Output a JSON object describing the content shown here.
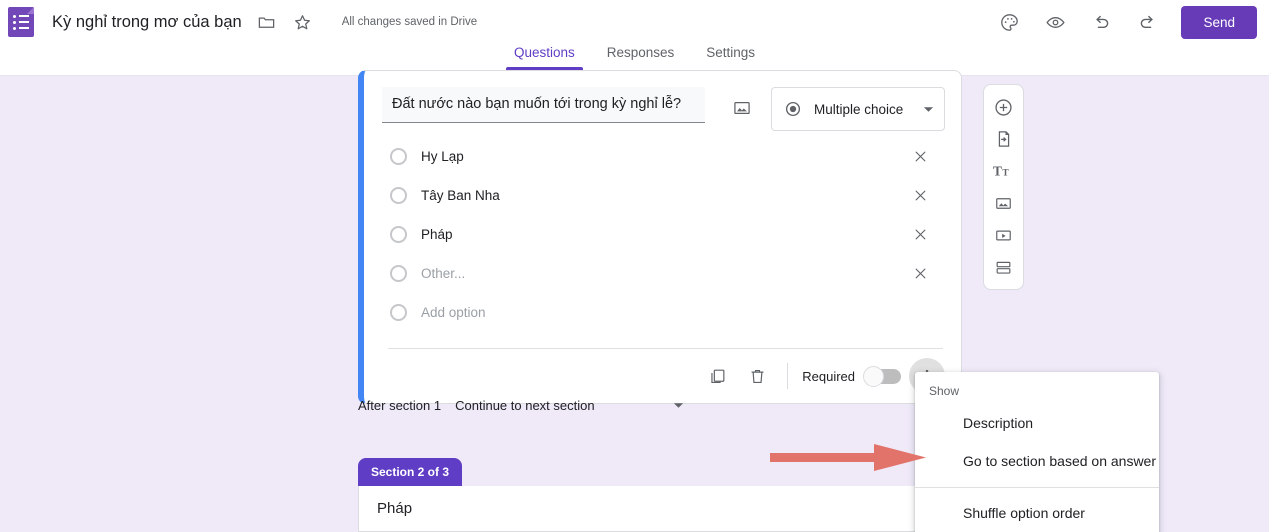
{
  "header": {
    "logo_icon": "google-forms-logo",
    "doc_title": "Kỳ nghỉ trong mơ của bạn",
    "folder_icon": "folder-icon",
    "star_icon": "star-icon",
    "save_status": "All changes saved in Drive",
    "palette_icon": "palette-icon",
    "preview_icon": "eye-preview-icon",
    "undo_icon": "undo-icon",
    "redo_icon": "redo-icon",
    "send_label": "Send",
    "accent_color": "#673ab7"
  },
  "tabs": [
    {
      "label": "Questions",
      "active": true
    },
    {
      "label": "Responses",
      "active": false
    },
    {
      "label": "Settings",
      "active": false
    }
  ],
  "question_card": {
    "accent_color": "#4285f4",
    "title": "Đất nước nào bạn muốn tới trong kỳ nghỉ lễ?",
    "image_icon": "add-image-icon",
    "type": {
      "icon": "radio-selected-icon",
      "label": "Multiple choice",
      "caret_icon": "chevron-down-icon"
    },
    "options": [
      {
        "label": "Hy Lạp",
        "muted": false,
        "removable": true
      },
      {
        "label": "Tây Ban Nha",
        "muted": false,
        "removable": true
      },
      {
        "label": "Pháp",
        "muted": false,
        "removable": true
      },
      {
        "label": "Other...",
        "muted": true,
        "removable": true
      },
      {
        "label": "Add option",
        "muted": true,
        "removable": false
      }
    ],
    "remove_icon": "close-x-icon",
    "footer": {
      "duplicate_icon": "duplicate-icon",
      "delete_icon": "trash-icon",
      "required_label": "Required",
      "required_on": false,
      "more_icon": "more-vertical-icon"
    }
  },
  "after_section": {
    "label": "After section 1",
    "value": "Continue to next section",
    "caret_icon": "chevron-down-icon"
  },
  "section2": {
    "badge": "Section 2 of 3",
    "title": "Pháp",
    "collapse_icon": "expand-collapse-chevrons-icon",
    "badge_color": "#5f3dc4"
  },
  "float_toolbar": [
    {
      "icon": "add-question-icon"
    },
    {
      "icon": "import-questions-icon"
    },
    {
      "icon": "add-title-description-icon"
    },
    {
      "icon": "add-image-icon"
    },
    {
      "icon": "add-video-icon"
    },
    {
      "icon": "add-section-icon"
    }
  ],
  "menu": {
    "header": "Show",
    "items": [
      {
        "label": "Description"
      },
      {
        "label": "Go to section based on answer"
      }
    ],
    "items_after_divider": [
      {
        "label": "Shuffle option order"
      }
    ]
  },
  "annotation": {
    "arrow_color": "#e2736a",
    "points_to": "Go to section based on answer"
  }
}
